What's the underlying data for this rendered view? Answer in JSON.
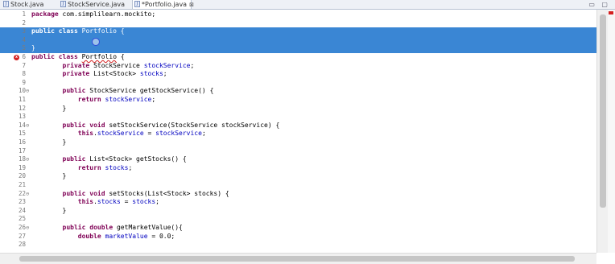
{
  "tabs": [
    {
      "label": "Stock.java",
      "active": false
    },
    {
      "label": "StockService.java",
      "active": false
    },
    {
      "label": "*Portfolio.java",
      "active": true
    }
  ],
  "tab_close_glyph": "⊠",
  "window_controls": "▭ ▢",
  "editor": {
    "lines": [
      {
        "num": "1",
        "fold": "",
        "code": "package com.simplilearn.mockito;"
      },
      {
        "num": "2",
        "fold": "",
        "code": ""
      },
      {
        "num": "3",
        "fold": "",
        "code": "public class Portfolio {"
      },
      {
        "num": "4",
        "fold": "",
        "code": ""
      },
      {
        "num": "5",
        "fold": "",
        "code": "}"
      },
      {
        "num": "6",
        "fold": "",
        "code": "public class Portfolio {"
      },
      {
        "num": "7",
        "fold": "",
        "code": "        private StockService stockService;"
      },
      {
        "num": "8",
        "fold": "",
        "code": "        private List<Stock> stocks;"
      },
      {
        "num": "9",
        "fold": "",
        "code": ""
      },
      {
        "num": "10",
        "fold": "⊖",
        "code": "        public StockService getStockService() {"
      },
      {
        "num": "11",
        "fold": "",
        "code": "            return stockService;"
      },
      {
        "num": "12",
        "fold": "",
        "code": "        }"
      },
      {
        "num": "13",
        "fold": "",
        "code": ""
      },
      {
        "num": "14",
        "fold": "⊖",
        "code": "        public void setStockService(StockService stockService) {"
      },
      {
        "num": "15",
        "fold": "",
        "code": "            this.stockService = stockService;"
      },
      {
        "num": "16",
        "fold": "",
        "code": "        }"
      },
      {
        "num": "17",
        "fold": "",
        "code": ""
      },
      {
        "num": "18",
        "fold": "⊖",
        "code": "        public List<Stock> getStocks() {"
      },
      {
        "num": "19",
        "fold": "",
        "code": "            return stocks;"
      },
      {
        "num": "20",
        "fold": "",
        "code": "        }"
      },
      {
        "num": "21",
        "fold": "",
        "code": ""
      },
      {
        "num": "22",
        "fold": "⊖",
        "code": "        public void setStocks(List<Stock> stocks) {"
      },
      {
        "num": "23",
        "fold": "",
        "code": "            this.stocks = stocks;"
      },
      {
        "num": "24",
        "fold": "",
        "code": "        }"
      },
      {
        "num": "25",
        "fold": "",
        "code": ""
      },
      {
        "num": "26",
        "fold": "⊖",
        "code": "        public double getMarketValue(){"
      },
      {
        "num": "27",
        "fold": "",
        "code": "            double marketValue = 0.0;"
      },
      {
        "num": "28",
        "fold": "",
        "code": ""
      }
    ],
    "selected_lines": [
      "3",
      "4",
      "5"
    ],
    "error_line": "6",
    "error_glyph": "x"
  },
  "colors": {
    "keyword": "#7f0055",
    "field": "#0000c0",
    "selection": "#3a86d4",
    "error": "#d42020"
  }
}
